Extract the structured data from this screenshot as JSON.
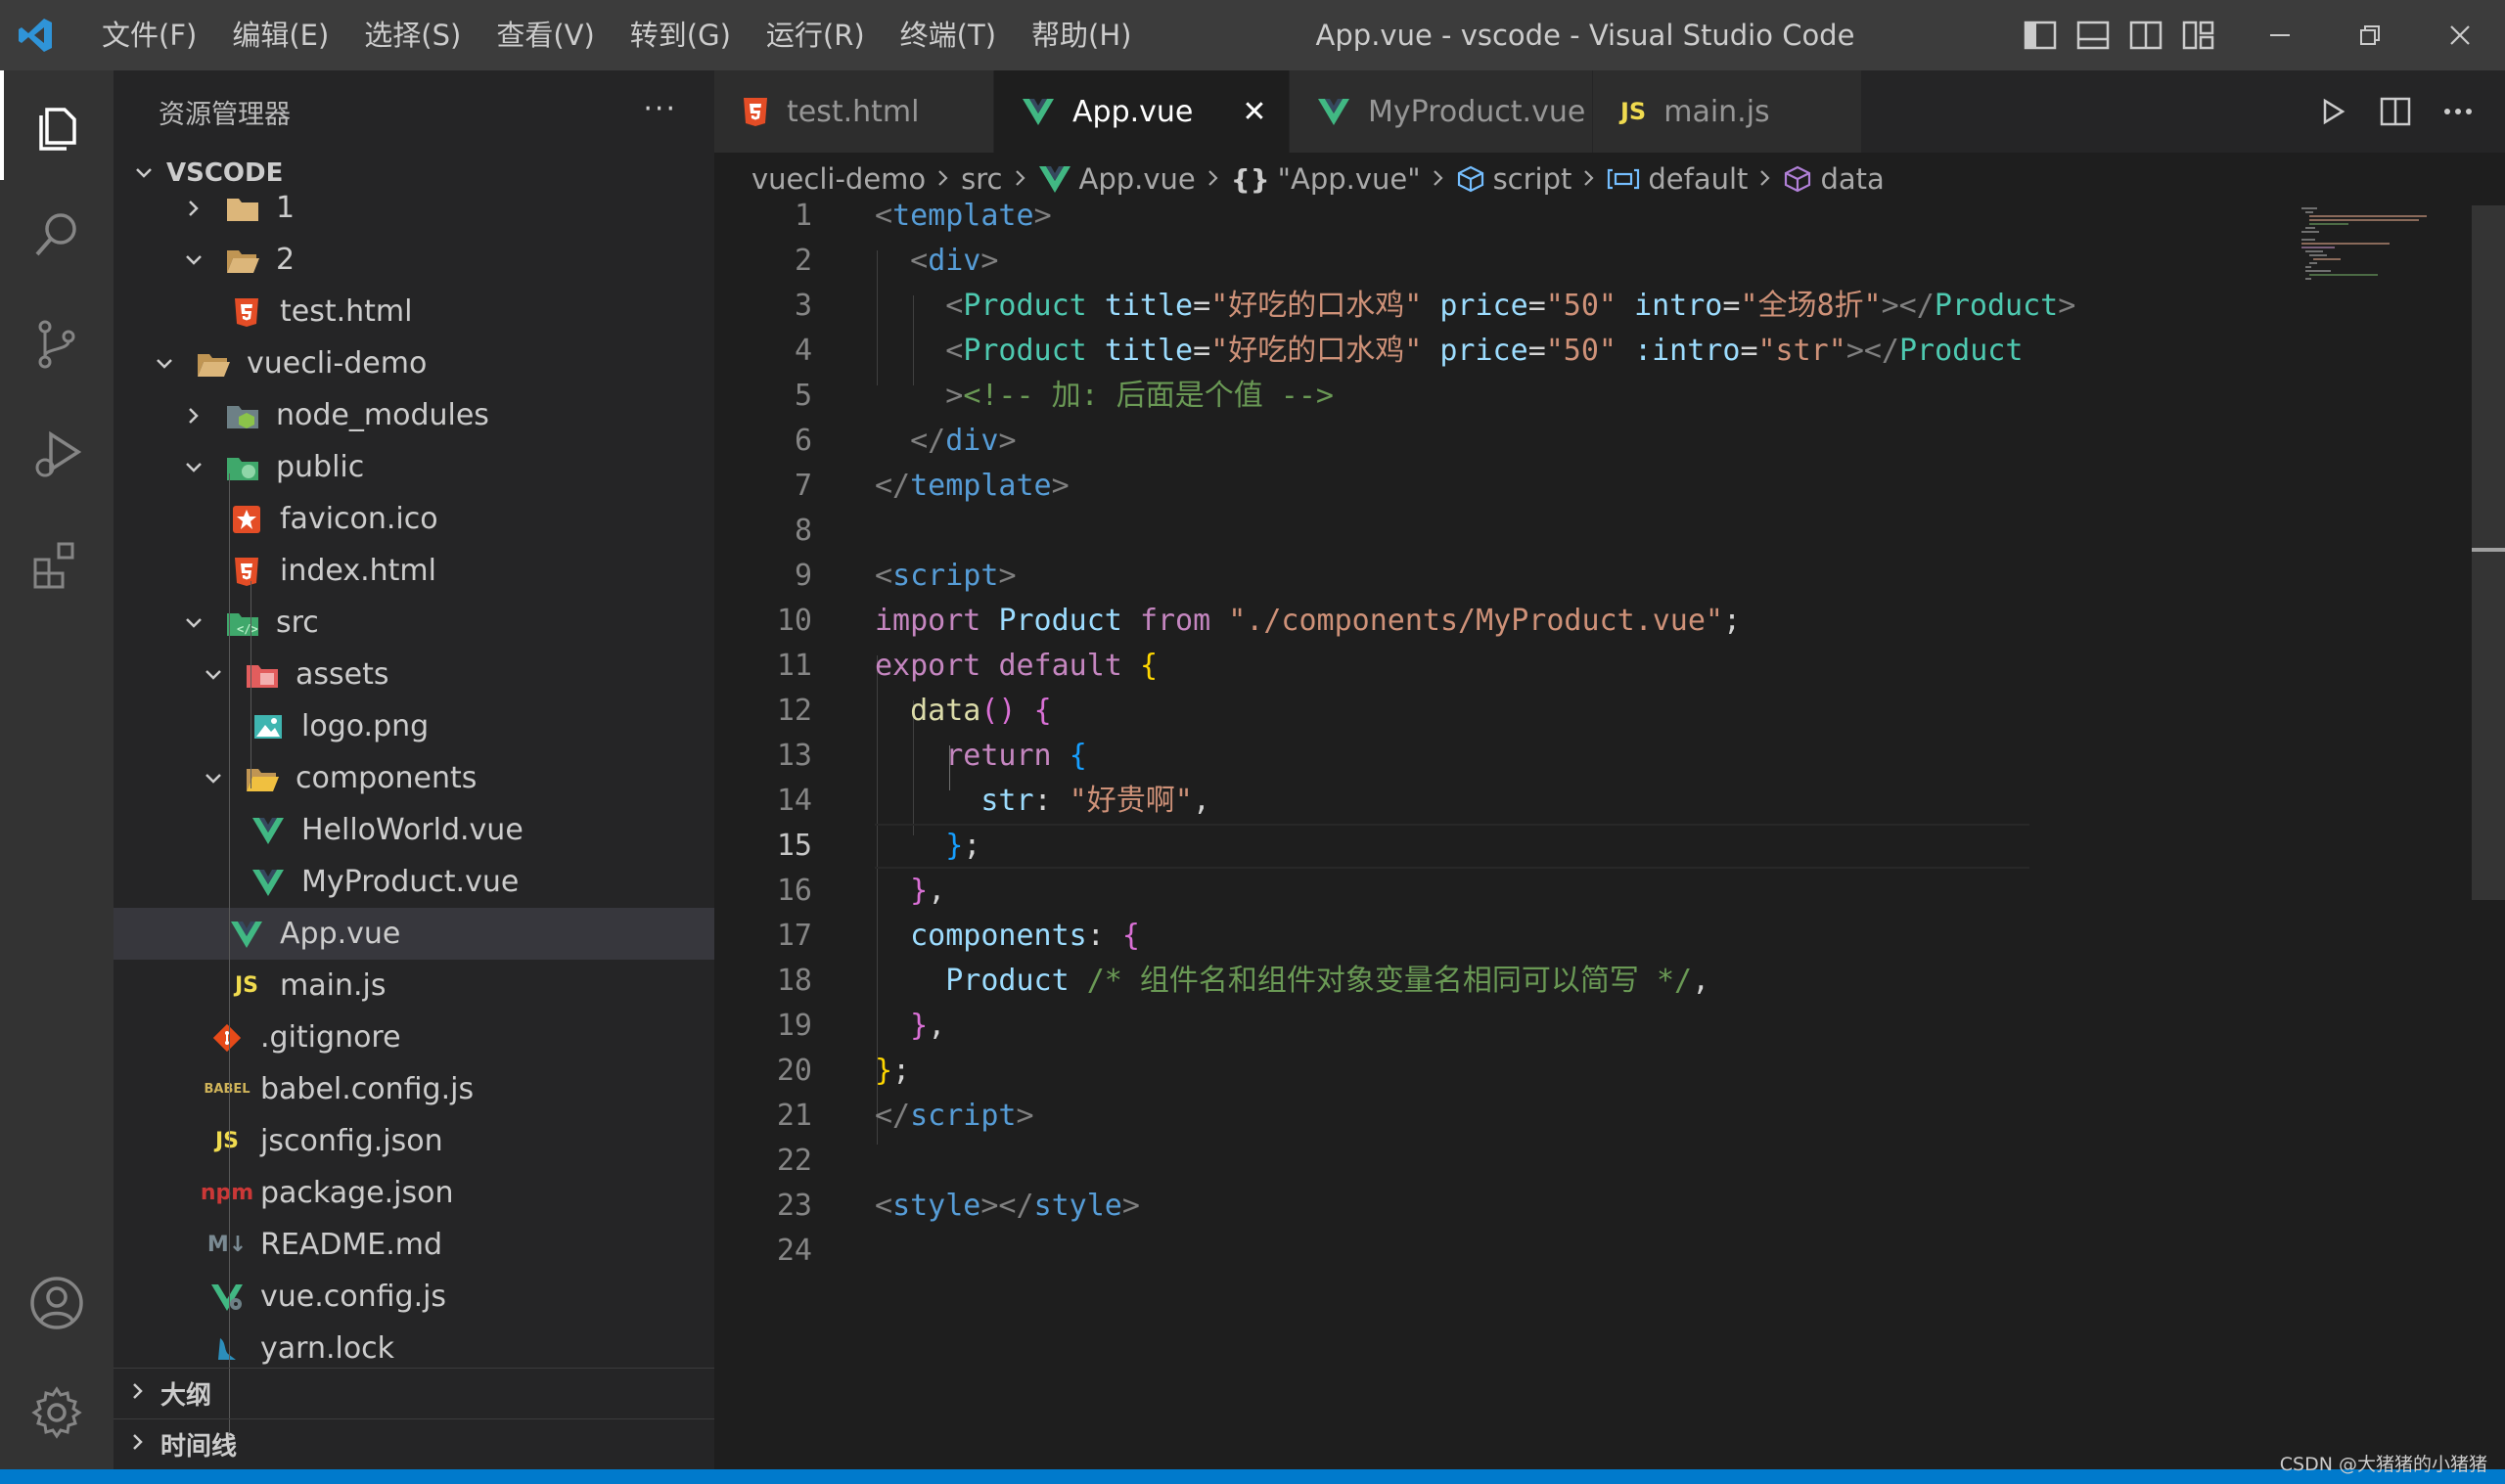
{
  "window": {
    "title": "App.vue - vscode - Visual Studio Code",
    "menu": [
      "文件(F)",
      "编辑(E)",
      "选择(S)",
      "查看(V)",
      "转到(G)",
      "运行(R)",
      "终端(T)",
      "帮助(H)"
    ]
  },
  "activity_bar": {
    "items": [
      "explorer-icon",
      "search-icon",
      "source-control-icon",
      "run-debug-icon",
      "extensions-icon"
    ],
    "bottom": [
      "account-icon",
      "settings-gear-icon"
    ]
  },
  "sidebar": {
    "title": "资源管理器",
    "more": "···",
    "section": "VSCODE",
    "tree": [
      {
        "label": "1",
        "icon": "folder-icon",
        "expanded": false
      },
      {
        "label": "2",
        "icon": "folder-open-icon",
        "expanded": true
      },
      {
        "label": "test.html",
        "icon": "html-file-icon"
      },
      {
        "label": "vuecli-demo",
        "icon": "folder-open-icon",
        "expanded": true
      },
      {
        "label": "node_modules",
        "icon": "node-folder-icon",
        "expanded": false
      },
      {
        "label": "public",
        "icon": "public-folder-icon",
        "expanded": true
      },
      {
        "label": "favicon.ico",
        "icon": "favicon-icon"
      },
      {
        "label": "index.html",
        "icon": "html-file-icon"
      },
      {
        "label": "src",
        "icon": "src-folder-icon",
        "expanded": true
      },
      {
        "label": "assets",
        "icon": "assets-folder-icon",
        "expanded": true
      },
      {
        "label": "logo.png",
        "icon": "image-file-icon"
      },
      {
        "label": "components",
        "icon": "components-folder-icon",
        "expanded": true
      },
      {
        "label": "HelloWorld.vue",
        "icon": "vue-file-icon"
      },
      {
        "label": "MyProduct.vue",
        "icon": "vue-file-icon"
      },
      {
        "label": "App.vue",
        "icon": "vue-file-icon",
        "selected": true
      },
      {
        "label": "main.js",
        "icon": "js-file-icon",
        "badge": "JS"
      },
      {
        "label": ".gitignore",
        "icon": "git-file-icon"
      },
      {
        "label": "babel.config.js",
        "icon": "babel-file-icon",
        "badge": "BABEL"
      },
      {
        "label": "jsconfig.json",
        "icon": "jsconfig-file-icon",
        "badge": "JS"
      },
      {
        "label": "package.json",
        "icon": "npm-file-icon",
        "badge": "npm"
      },
      {
        "label": "README.md",
        "icon": "markdown-file-icon",
        "badge": "M↓"
      },
      {
        "label": "vue.config.js",
        "icon": "vue-config-file-icon"
      },
      {
        "label": "yarn.lock",
        "icon": "yarn-file-icon"
      }
    ],
    "bottom_sections": [
      "大纲",
      "时间线"
    ]
  },
  "tabs": [
    {
      "label": "test.html",
      "icon": "html-file-icon",
      "active": false
    },
    {
      "label": "App.vue",
      "icon": "vue-file-icon",
      "active": true,
      "close": "✕"
    },
    {
      "label": "MyProduct.vue",
      "icon": "vue-file-icon",
      "active": false
    },
    {
      "label": "main.js",
      "icon": "js-file-icon",
      "badge": "JS",
      "active": false
    }
  ],
  "breadcrumb": [
    {
      "label": "vuecli-demo"
    },
    {
      "label": "src"
    },
    {
      "label": "App.vue",
      "icon": "vue-file-icon"
    },
    {
      "label": "\"App.vue\"",
      "icon": "braces-icon",
      "badge": "{}"
    },
    {
      "label": "script",
      "icon": "module-icon"
    },
    {
      "label": "default",
      "icon": "variable-icon"
    },
    {
      "label": "data",
      "icon": "method-icon"
    }
  ],
  "editor": {
    "current_line": 15,
    "lines": [
      [
        [
          "t-punc",
          "<"
        ],
        [
          "t-tag",
          "template"
        ],
        [
          "t-punc",
          ">"
        ]
      ],
      [
        [
          "t-plain",
          "  "
        ],
        [
          "t-punc",
          "<"
        ],
        [
          "t-tag",
          "div"
        ],
        [
          "t-punc",
          ">"
        ]
      ],
      [
        [
          "t-plain",
          "    "
        ],
        [
          "t-punc",
          "<"
        ],
        [
          "t-comp",
          "Product"
        ],
        [
          "t-plain",
          " "
        ],
        [
          "t-attr",
          "title"
        ],
        [
          "t-plain",
          "="
        ],
        [
          "t-str",
          "\"好吃的口水鸡\""
        ],
        [
          "t-plain",
          " "
        ],
        [
          "t-attr",
          "price"
        ],
        [
          "t-plain",
          "="
        ],
        [
          "t-str",
          "\"50\""
        ],
        [
          "t-plain",
          " "
        ],
        [
          "t-attr",
          "intro"
        ],
        [
          "t-plain",
          "="
        ],
        [
          "t-str",
          "\"全场8折\""
        ],
        [
          "t-punc",
          "></"
        ],
        [
          "t-comp",
          "Product"
        ],
        [
          "t-punc",
          ">"
        ]
      ],
      [
        [
          "t-plain",
          "    "
        ],
        [
          "t-punc",
          "<"
        ],
        [
          "t-comp",
          "Product"
        ],
        [
          "t-plain",
          " "
        ],
        [
          "t-attr",
          "title"
        ],
        [
          "t-plain",
          "="
        ],
        [
          "t-str",
          "\"好吃的口水鸡\""
        ],
        [
          "t-plain",
          " "
        ],
        [
          "t-attr",
          "price"
        ],
        [
          "t-plain",
          "="
        ],
        [
          "t-str",
          "\"50\""
        ],
        [
          "t-plain",
          " "
        ],
        [
          "t-attr",
          ":intro"
        ],
        [
          "t-plain",
          "="
        ],
        [
          "t-str",
          "\"str\""
        ],
        [
          "t-punc",
          "></"
        ],
        [
          "t-comp",
          "Product"
        ]
      ],
      [
        [
          "t-plain",
          "    "
        ],
        [
          "t-punc",
          ">"
        ],
        [
          "t-com",
          "<!-- 加: 后面是个值 -->"
        ]
      ],
      [
        [
          "t-plain",
          "  "
        ],
        [
          "t-punc",
          "</"
        ],
        [
          "t-tag",
          "div"
        ],
        [
          "t-punc",
          ">"
        ]
      ],
      [
        [
          "t-punc",
          "</"
        ],
        [
          "t-tag",
          "template"
        ],
        [
          "t-punc",
          ">"
        ]
      ],
      [],
      [
        [
          "t-punc",
          "<"
        ],
        [
          "t-tag",
          "script"
        ],
        [
          "t-punc",
          ">"
        ]
      ],
      [
        [
          "t-kw",
          "import"
        ],
        [
          "t-plain",
          " "
        ],
        [
          "t-attr",
          "Product"
        ],
        [
          "t-plain",
          " "
        ],
        [
          "t-kw",
          "from"
        ],
        [
          "t-plain",
          " "
        ],
        [
          "t-str",
          "\"./components/MyProduct.vue\""
        ],
        [
          "t-plain",
          ";"
        ]
      ],
      [
        [
          "t-kw",
          "export"
        ],
        [
          "t-plain",
          " "
        ],
        [
          "t-kw",
          "default"
        ],
        [
          "t-plain",
          " "
        ],
        [
          "t-b1",
          "{"
        ]
      ],
      [
        [
          "t-plain",
          "  "
        ],
        [
          "t-fn",
          "data"
        ],
        [
          "t-b2",
          "()"
        ],
        [
          "t-plain",
          " "
        ],
        [
          "t-b2",
          "{"
        ]
      ],
      [
        [
          "t-plain",
          "    "
        ],
        [
          "t-kw",
          "return"
        ],
        [
          "t-plain",
          " "
        ],
        [
          "t-b3",
          "{"
        ]
      ],
      [
        [
          "t-plain",
          "      "
        ],
        [
          "t-attr",
          "str"
        ],
        [
          "t-plain",
          ": "
        ],
        [
          "t-str",
          "\"好贵啊\""
        ],
        [
          "t-plain",
          ","
        ]
      ],
      [
        [
          "t-plain",
          "    "
        ],
        [
          "t-b3",
          "}"
        ],
        [
          "t-plain",
          ";"
        ]
      ],
      [
        [
          "t-plain",
          "  "
        ],
        [
          "t-b2",
          "}"
        ],
        [
          "t-plain",
          ","
        ]
      ],
      [
        [
          "t-plain",
          "  "
        ],
        [
          "t-attr",
          "components"
        ],
        [
          "t-plain",
          ": "
        ],
        [
          "t-b2",
          "{"
        ]
      ],
      [
        [
          "t-plain",
          "    "
        ],
        [
          "t-attr",
          "Product"
        ],
        [
          "t-plain",
          " "
        ],
        [
          "t-com",
          "/* 组件名和组件对象变量名相同可以简写 */"
        ],
        [
          "t-plain",
          ","
        ]
      ],
      [
        [
          "t-plain",
          "  "
        ],
        [
          "t-b2",
          "}"
        ],
        [
          "t-plain",
          ","
        ]
      ],
      [
        [
          "t-b1",
          "}"
        ],
        [
          "t-plain",
          ";"
        ]
      ],
      [
        [
          "t-punc",
          "</"
        ],
        [
          "t-tag",
          "script"
        ],
        [
          "t-punc",
          ">"
        ]
      ],
      [],
      [
        [
          "t-punc",
          "<"
        ],
        [
          "t-tag",
          "style"
        ],
        [
          "t-punc",
          "></"
        ],
        [
          "t-tag",
          "style"
        ],
        [
          "t-punc",
          ">"
        ]
      ],
      []
    ]
  },
  "watermark": "CSDN @大猪猪的小猪猪"
}
